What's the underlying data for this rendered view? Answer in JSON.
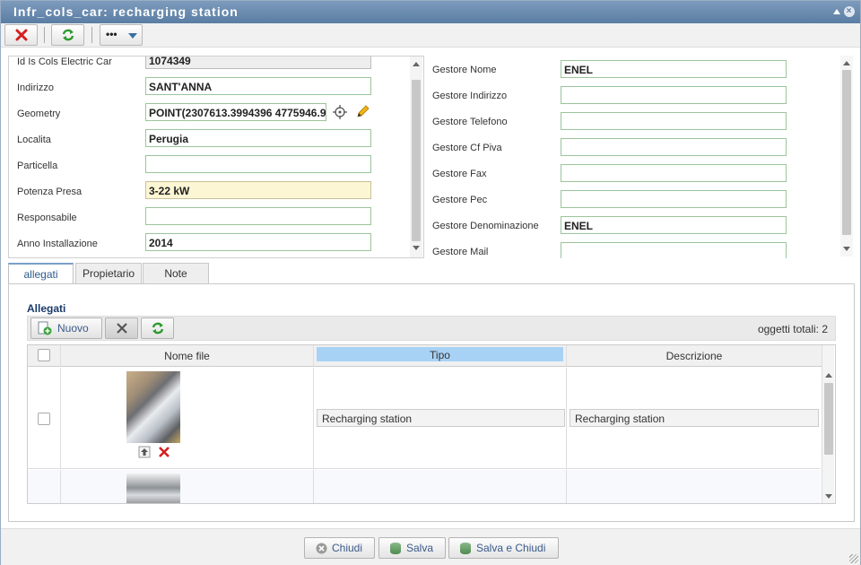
{
  "window": {
    "title": "Infr_cols_car: recharging station"
  },
  "left_fields": [
    {
      "label": "Id Is Cols Electric Car",
      "value": "1074349"
    },
    {
      "label": "Indirizzo",
      "value": "SANT'ANNA"
    },
    {
      "label": "Geometry",
      "value": "POINT(2307613.3994396 4775946.9"
    },
    {
      "label": "Localita",
      "value": "Perugia"
    },
    {
      "label": "Particella",
      "value": ""
    },
    {
      "label": "Potenza Presa",
      "value": "3-22 kW"
    },
    {
      "label": "Responsabile",
      "value": ""
    },
    {
      "label": "Anno Installazione",
      "value": "2014"
    }
  ],
  "right_fields": [
    {
      "label": "Gestore Nome",
      "value": "ENEL"
    },
    {
      "label": "Gestore Indirizzo",
      "value": ""
    },
    {
      "label": "Gestore Telefono",
      "value": ""
    },
    {
      "label": "Gestore Cf Piva",
      "value": ""
    },
    {
      "label": "Gestore Fax",
      "value": ""
    },
    {
      "label": "Gestore Pec",
      "value": ""
    },
    {
      "label": "Gestore Denominazione",
      "value": "ENEL"
    },
    {
      "label": "Gestore Mail",
      "value": ""
    }
  ],
  "tabs": [
    "allegati",
    "Propietario",
    "Note"
  ],
  "allegati": {
    "title": "Allegati",
    "new_label": "Nuovo",
    "total_label": "oggetti totali: 2",
    "columns": [
      "Nome file",
      "Tipo",
      "Descrizione"
    ],
    "rows": [
      {
        "tipo": "Recharging station",
        "descrizione": "Recharging station"
      },
      {
        "tipo": "",
        "descrizione": ""
      }
    ]
  },
  "footer": {
    "close": "Chiudi",
    "save": "Salva",
    "save_close": "Salva e Chiudi"
  },
  "colors": {
    "title_bar": "#6a8bb1",
    "input_border": "#9bc49b",
    "highlight_field": "#fdf6d4",
    "header_selected": "#a8d2f5"
  }
}
